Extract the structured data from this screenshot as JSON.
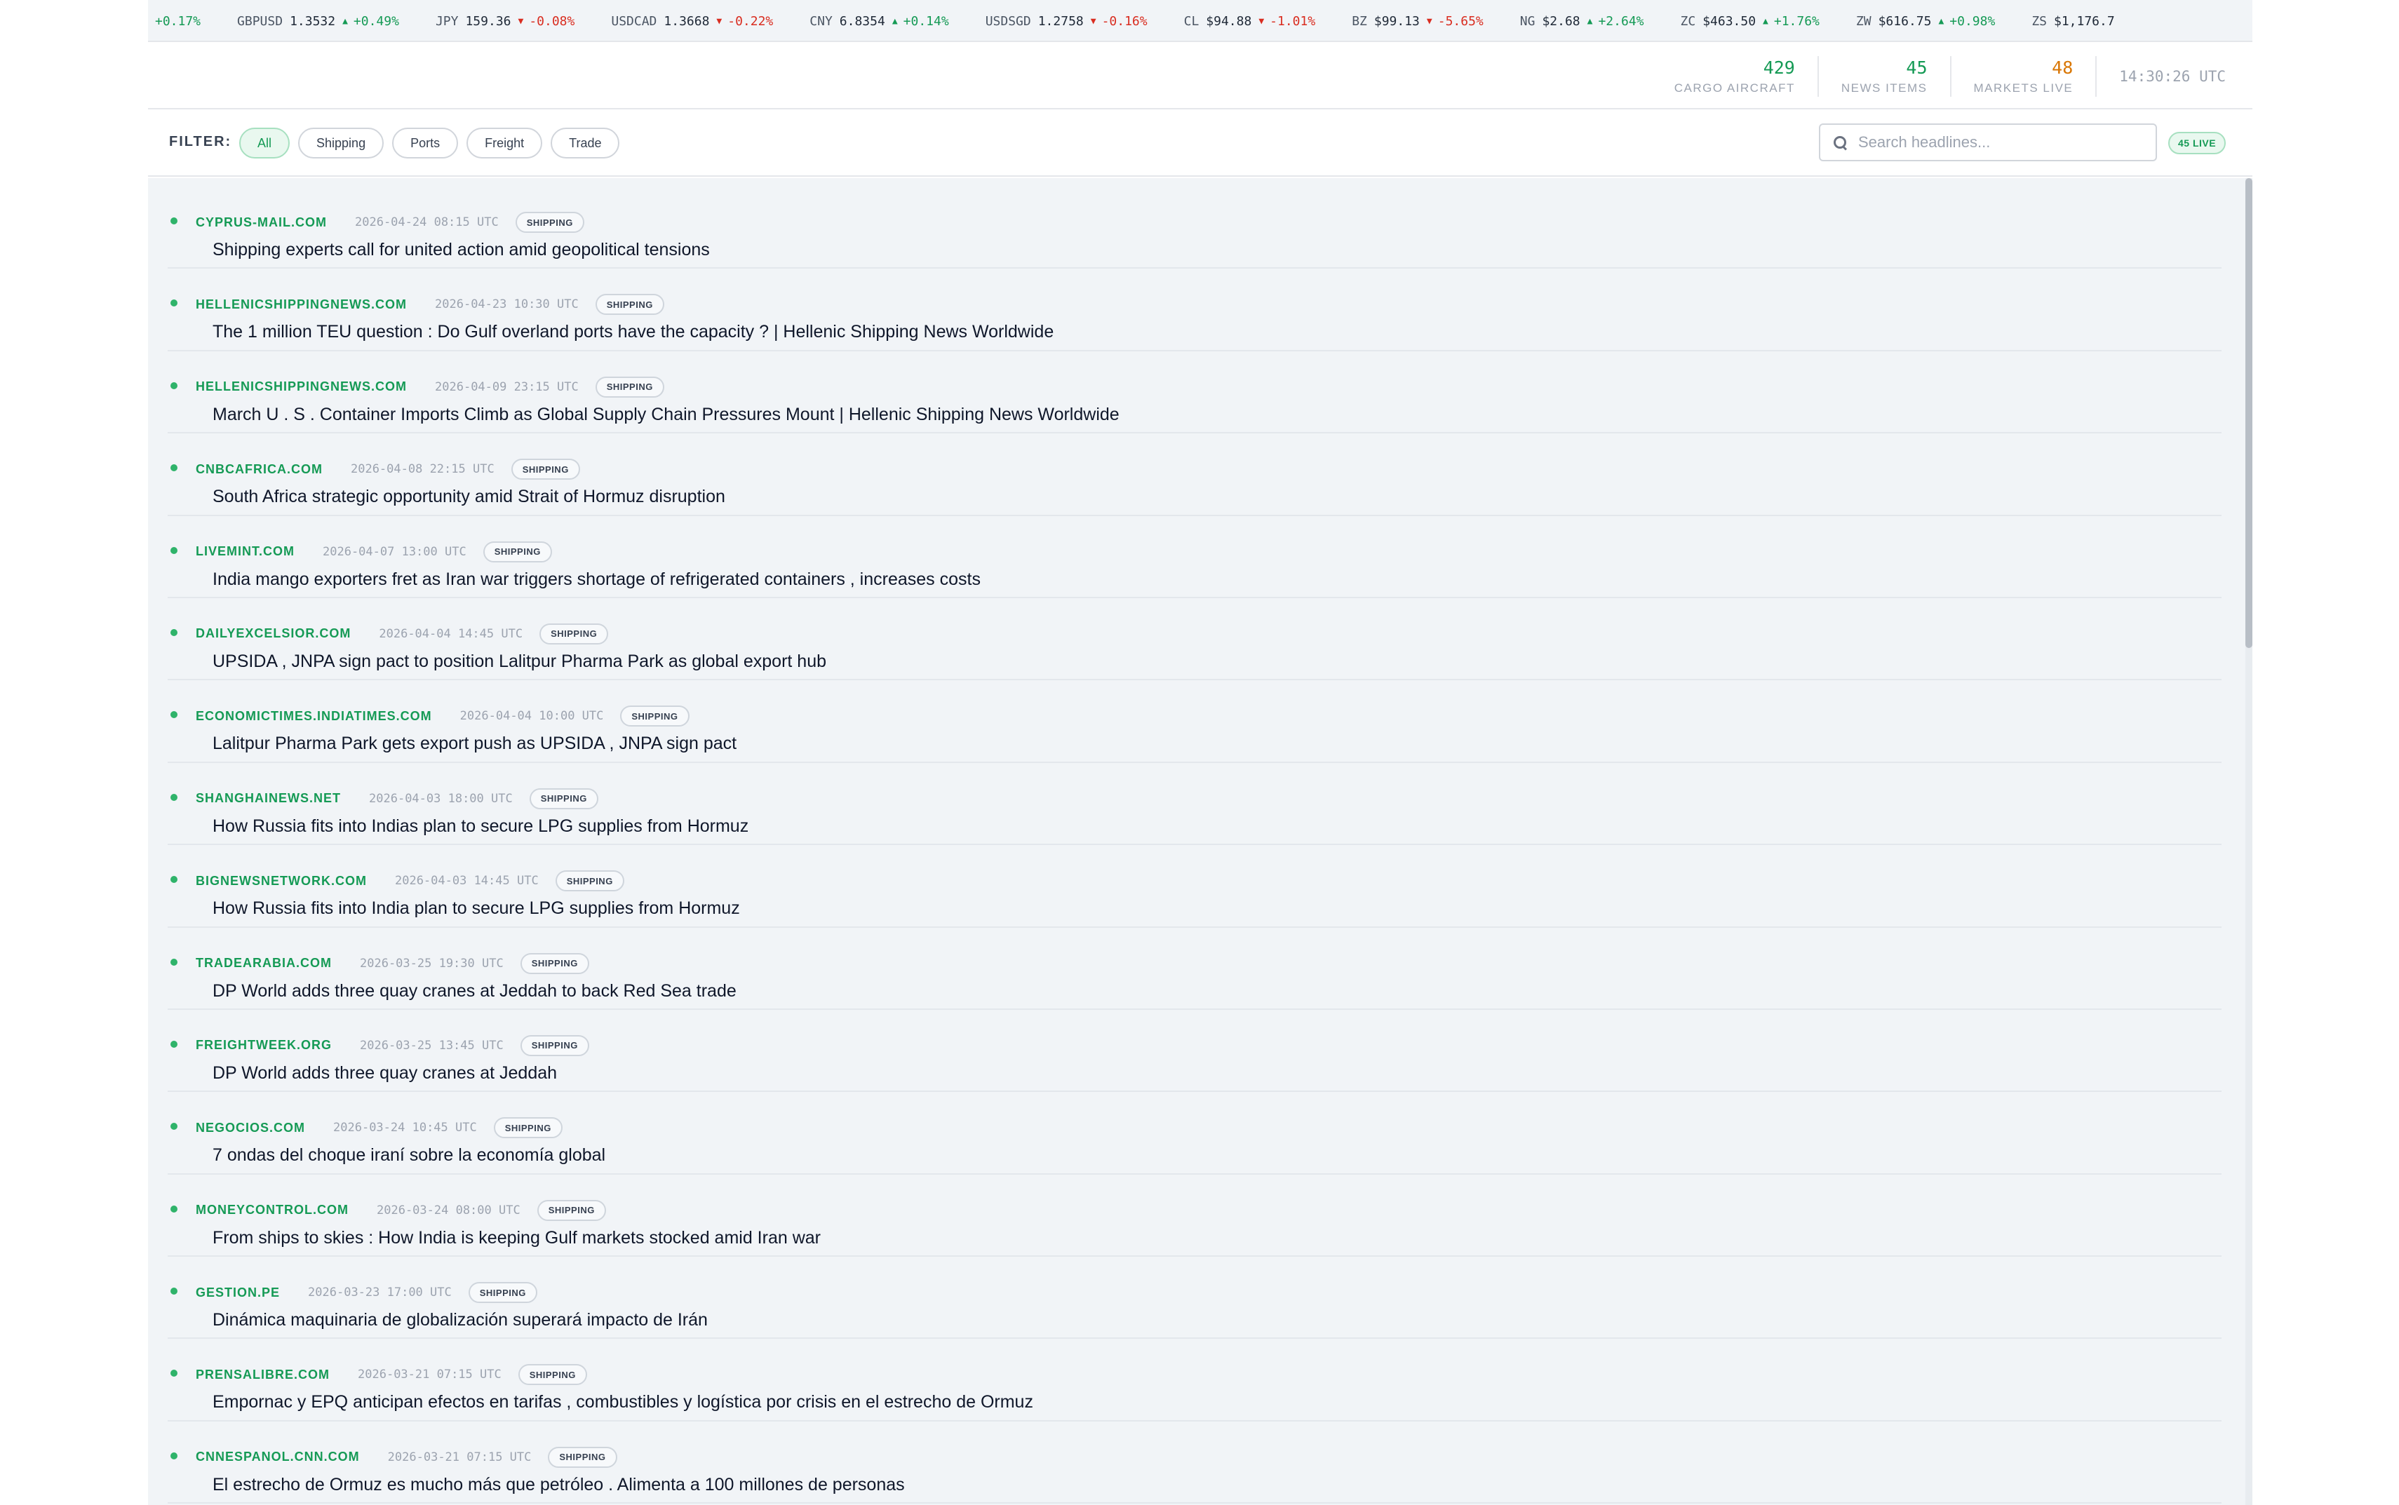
{
  "ticker": [
    {
      "symbol": "",
      "price": "",
      "change": "+0.17%",
      "dir": "up"
    },
    {
      "symbol": "GBPUSD",
      "price": "1.3532",
      "change": "+0.49%",
      "dir": "up"
    },
    {
      "symbol": "JPY",
      "price": "159.36",
      "change": "-0.08%",
      "dir": "down"
    },
    {
      "symbol": "USDCAD",
      "price": "1.3668",
      "change": "-0.22%",
      "dir": "down"
    },
    {
      "symbol": "CNY",
      "price": "6.8354",
      "change": "+0.14%",
      "dir": "up"
    },
    {
      "symbol": "USDSGD",
      "price": "1.2758",
      "change": "-0.16%",
      "dir": "down"
    },
    {
      "symbol": "CL",
      "price": "$94.88",
      "change": "-1.01%",
      "dir": "down"
    },
    {
      "symbol": "BZ",
      "price": "$99.13",
      "change": "-5.65%",
      "dir": "down"
    },
    {
      "symbol": "NG",
      "price": "$2.68",
      "change": "+2.64%",
      "dir": "up"
    },
    {
      "symbol": "ZC",
      "price": "$463.50",
      "change": "+1.76%",
      "dir": "up"
    },
    {
      "symbol": "ZW",
      "price": "$616.75",
      "change": "+0.98%",
      "dir": "up"
    },
    {
      "symbol": "ZS",
      "price": "$1,176.7",
      "change": "",
      "dir": "up"
    }
  ],
  "stats": {
    "cargo_aircraft": {
      "value": "429",
      "label": "CARGO AIRCRAFT"
    },
    "news_items": {
      "value": "45",
      "label": "NEWS ITEMS"
    },
    "markets_live": {
      "value": "48",
      "label": "MARKETS LIVE"
    },
    "clock": "14:30:26 UTC"
  },
  "filter": {
    "label": "FILTER:",
    "chips": [
      "All",
      "Shipping",
      "Ports",
      "Freight",
      "Trade"
    ],
    "active": "All"
  },
  "search": {
    "placeholder": "Search headlines...",
    "value": ""
  },
  "live_badge": "45 LIVE",
  "news": [
    {
      "source": "CYPRUS-MAIL.COM",
      "time": "2026-04-24 08:15 UTC",
      "tag": "SHIPPING",
      "title": "Shipping experts call for united action amid geopolitical tensions"
    },
    {
      "source": "HELLENICSHIPPINGNEWS.COM",
      "time": "2026-04-23 10:30 UTC",
      "tag": "SHIPPING",
      "title": "The 1 million TEU question : Do Gulf overland ports have the capacity ? | Hellenic Shipping News Worldwide"
    },
    {
      "source": "HELLENICSHIPPINGNEWS.COM",
      "time": "2026-04-09 23:15 UTC",
      "tag": "SHIPPING",
      "title": "March U . S . Container Imports Climb as Global Supply Chain Pressures Mount | Hellenic Shipping News Worldwide"
    },
    {
      "source": "CNBCAFRICA.COM",
      "time": "2026-04-08 22:15 UTC",
      "tag": "SHIPPING",
      "title": "South Africa strategic opportunity amid Strait of Hormuz disruption"
    },
    {
      "source": "LIVEMINT.COM",
      "time": "2026-04-07 13:00 UTC",
      "tag": "SHIPPING",
      "title": "India mango exporters fret as Iran war triggers shortage of refrigerated containers , increases costs"
    },
    {
      "source": "DAILYEXCELSIOR.COM",
      "time": "2026-04-04 14:45 UTC",
      "tag": "SHIPPING",
      "title": "UPSIDA , JNPA sign pact to position  Lalitpur Pharma Park as global export hub"
    },
    {
      "source": "ECONOMICTIMES.INDIATIMES.COM",
      "time": "2026-04-04 10:00 UTC",
      "tag": "SHIPPING",
      "title": "Lalitpur Pharma Park gets export push as UPSIDA , JNPA sign pact"
    },
    {
      "source": "SHANGHAINEWS.NET",
      "time": "2026-04-03 18:00 UTC",
      "tag": "SHIPPING",
      "title": "How Russia fits into Indias plan to secure LPG supplies from Hormuz"
    },
    {
      "source": "BIGNEWSNETWORK.COM",
      "time": "2026-04-03 14:45 UTC",
      "tag": "SHIPPING",
      "title": "How Russia fits into India plan to secure LPG supplies from Hormuz"
    },
    {
      "source": "TRADEARABIA.COM",
      "time": "2026-03-25 19:30 UTC",
      "tag": "SHIPPING",
      "title": "DP World adds three quay cranes at Jeddah to back Red Sea trade"
    },
    {
      "source": "FREIGHTWEEK.ORG",
      "time": "2026-03-25 13:45 UTC",
      "tag": "SHIPPING",
      "title": "DP World adds three quay cranes at Jeddah"
    },
    {
      "source": "NEGOCIOS.COM",
      "time": "2026-03-24 10:45 UTC",
      "tag": "SHIPPING",
      "title": "7 ondas del choque iraní sobre la economía global"
    },
    {
      "source": "MONEYCONTROL.COM",
      "time": "2026-03-24 08:00 UTC",
      "tag": "SHIPPING",
      "title": "From ships to skies : How India is keeping Gulf markets stocked amid Iran war"
    },
    {
      "source": "GESTION.PE",
      "time": "2026-03-23 17:00 UTC",
      "tag": "SHIPPING",
      "title": "Dinámica maquinaria de globalización superará impacto de Irán"
    },
    {
      "source": "PRENSALIBRE.COM",
      "time": "2026-03-21 07:15 UTC",
      "tag": "SHIPPING",
      "title": "Empornac y EPQ anticipan efectos en tarifas , combustibles y logística por crisis en el estrecho de Ormuz"
    },
    {
      "source": "CNNESPANOL.CNN.COM",
      "time": "2026-03-21 07:15 UTC",
      "tag": "SHIPPING",
      "title": "El estrecho de Ormuz es mucho más que petróleo . Alimenta a 100 millones de personas"
    }
  ],
  "colors": {
    "accent": "#159a55",
    "up": "#159a55",
    "down": "#d92d20",
    "markets": "#d97706"
  }
}
